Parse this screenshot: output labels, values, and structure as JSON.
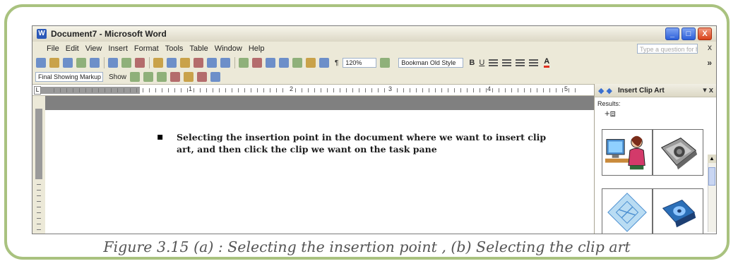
{
  "window": {
    "icon_label": "W",
    "title": "Document7 - Microsoft Word",
    "controls": {
      "minimize": "_",
      "maximize": "□",
      "close": "X"
    }
  },
  "menu": {
    "items": [
      "File",
      "Edit",
      "View",
      "Insert",
      "Format",
      "Tools",
      "Table",
      "Window",
      "Help"
    ],
    "help_placeholder": "Type a question for help",
    "close": "x"
  },
  "toolbar": {
    "zoom": "120%",
    "font": "Bookman Old Style",
    "bold": "B",
    "underline": "U",
    "font_color": "A",
    "more": "»"
  },
  "reviewing": {
    "markup": "Final Showing Markup",
    "show": "Show"
  },
  "ruler": {
    "marks": [
      "1",
      "2",
      "3",
      "4",
      "5"
    ]
  },
  "document": {
    "bullet": "▪",
    "text": "Selecting the insertion point in the document where we want to insert clip art, and then click the clip we want on the task pane"
  },
  "task_pane": {
    "title": "Insert Clip Art",
    "results_label": "Results:",
    "close": "x"
  },
  "caption": "Figure 3.15 (a) : Selecting the insertion point , (b) Selecting the clip art",
  "colors": {
    "frame_border": "#a9c27f",
    "caption_text": "#555555",
    "titlebar_close": "#d8421a"
  }
}
